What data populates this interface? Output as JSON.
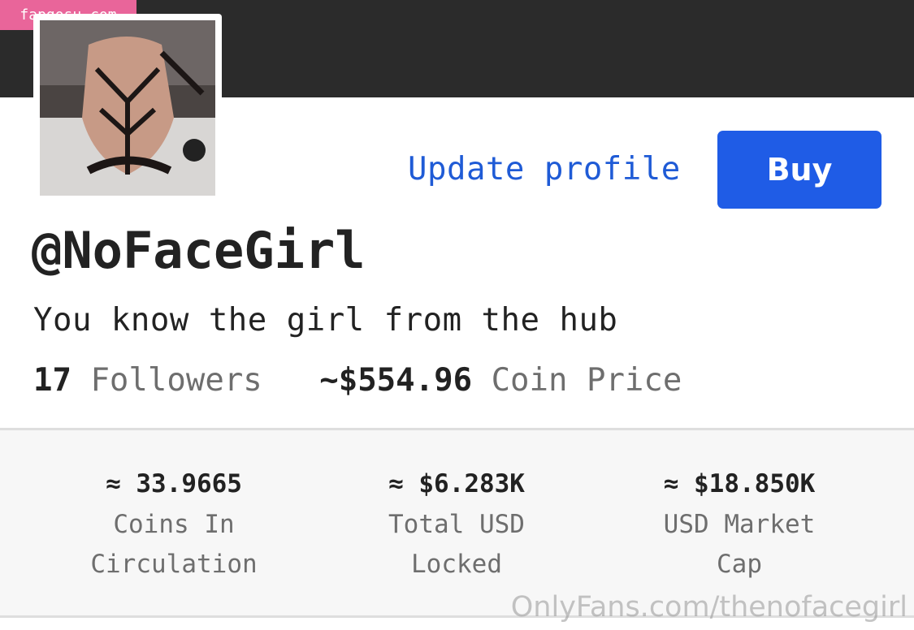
{
  "watermark": {
    "top": "fapgosu.com",
    "bottom": "OnlyFans.com/thenofacegirl"
  },
  "profile": {
    "update_label": "Update profile",
    "buy_label": "Buy",
    "username": "@NoFaceGirl",
    "bio": "You know the girl from the hub",
    "followers_count": "17",
    "followers_label": "Followers",
    "coin_price": "~$554.96",
    "coin_price_label": "Coin Price"
  },
  "metrics": [
    {
      "value": "≈ 33.9665",
      "label_line1": "Coins In",
      "label_line2": "Circulation"
    },
    {
      "value": "≈ $6.283K",
      "label_line1": "Total USD",
      "label_line2": "Locked"
    },
    {
      "value": "≈ $18.850K",
      "label_line1": "USD Market",
      "label_line2": "Cap"
    }
  ],
  "colors": {
    "banner": "#2b2b2b",
    "link": "#1f5bd6",
    "button": "#1f5ce6",
    "watermark_badge": "#e9659a"
  }
}
